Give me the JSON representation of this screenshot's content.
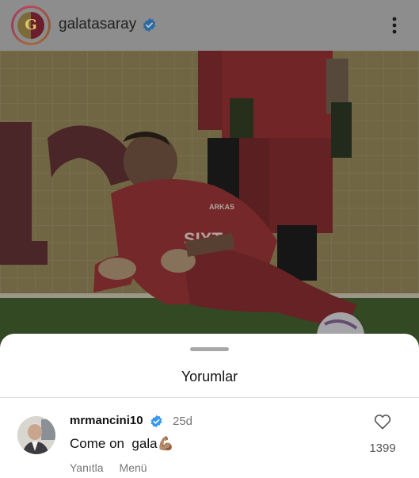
{
  "post": {
    "username": "galatasaray",
    "verified": true,
    "avatar_icon": "galatasaray-crest",
    "more_icon": "more-vertical-icon"
  },
  "photo": {
    "subject": "goalkeeper-diving-training",
    "jersey_sponsor_text": "SIXT",
    "sleeve_text": "ARKAS"
  },
  "comments_sheet": {
    "title": "Yorumlar",
    "comments": [
      {
        "username": "mrmancini10",
        "verified": true,
        "time": "25d",
        "text": "Come on  gala",
        "emoji": "💪🏽",
        "reply_label": "Yanıtla",
        "menu_label": "Menü",
        "like_count": "1399",
        "like_icon": "heart-outline-icon"
      }
    ]
  },
  "colors": {
    "verified_blue": "#3897f0",
    "dim_overlay": "#8d8d8d",
    "muted_text": "#777777"
  }
}
